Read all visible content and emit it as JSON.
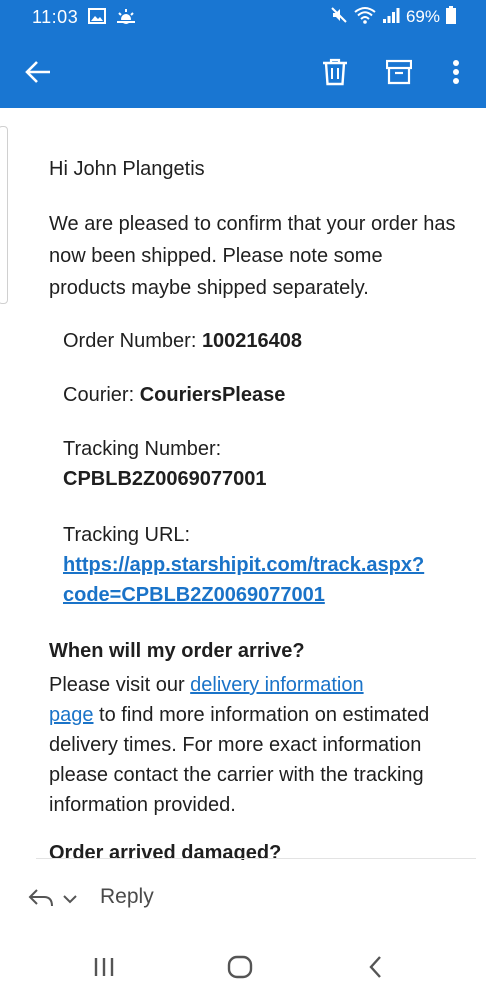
{
  "status_bar": {
    "time": "11:03",
    "battery": "69%"
  },
  "email": {
    "greeting": "Hi John Plangetis",
    "intro": "We are pleased to confirm that your order has now been shipped. Please note some products maybe shipped separately.",
    "order_number_label": "Order Number: ",
    "order_number": "100216408",
    "courier_label": "Courier: ",
    "courier": "CouriersPlease",
    "tracking_number_label": "Tracking Number:",
    "tracking_number": "CPBLB2Z0069077001",
    "tracking_url_label": "Tracking URL:",
    "tracking_url_line1": "https://app.starshipit.com/track.aspx?",
    "tracking_url_line2": "code=CPBLB2Z0069077001",
    "arrival_title": "When will my order arrive?",
    "arrival_text_1": "Please visit our ",
    "arrival_link_1": "delivery information",
    "arrival_link_2": "page",
    "arrival_text_2": " to find more information on estimated delivery times. For more exact information please contact the carrier with the tracking information provided.",
    "damaged_title": "Order arrived damaged?"
  },
  "reply_bar": {
    "label": "Reply"
  }
}
